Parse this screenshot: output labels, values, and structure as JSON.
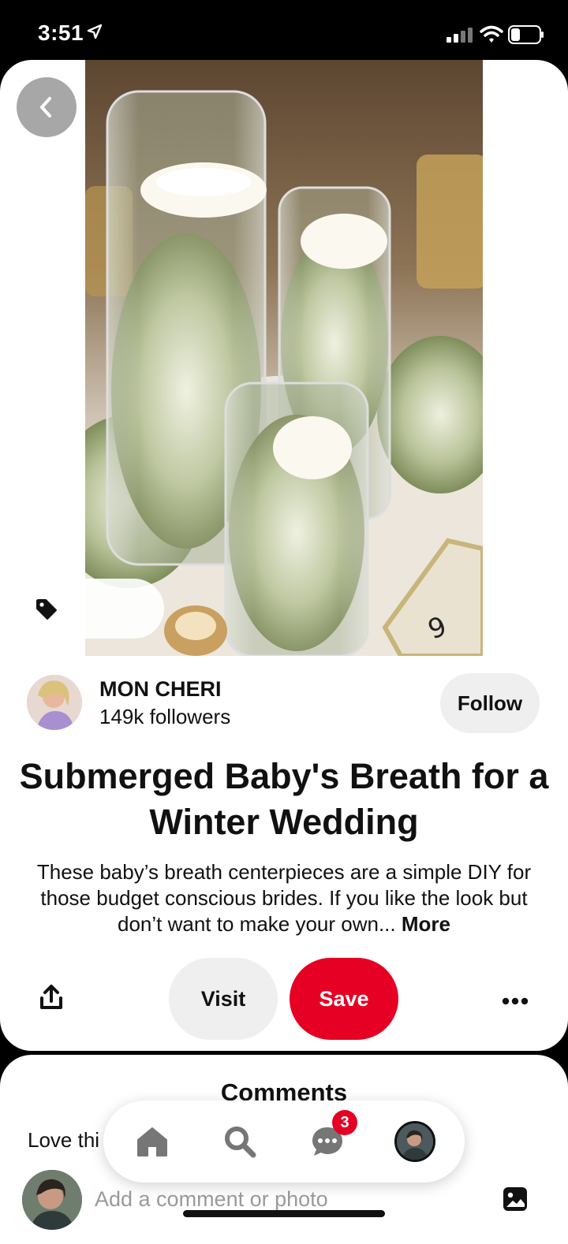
{
  "status_bar": {
    "time": "3:51"
  },
  "pin": {
    "image_alt": "Tall glass cylinder vases with submerged baby's breath and floating candles on a wedding table",
    "creator_name": "MON CHERI",
    "creator_followers": "149k followers",
    "follow_label": "Follow",
    "title": "Submerged Baby's Breath for a Winter Wedding",
    "description": "These baby’s breath centerpieces are a simple DIY for those budget conscious brides. If you like the look but don’t want to make your own...",
    "more_label": "More",
    "visit_label": "Visit",
    "save_label": "Save"
  },
  "comments": {
    "title": "Comments",
    "preview_text": "Love thi",
    "input_placeholder": "Add a comment or photo"
  },
  "nav": {
    "items": [
      "home",
      "search",
      "messages",
      "profile"
    ],
    "messages_badge": "3"
  },
  "colors": {
    "accent": "#e60023",
    "button_gray": "#efefef"
  }
}
